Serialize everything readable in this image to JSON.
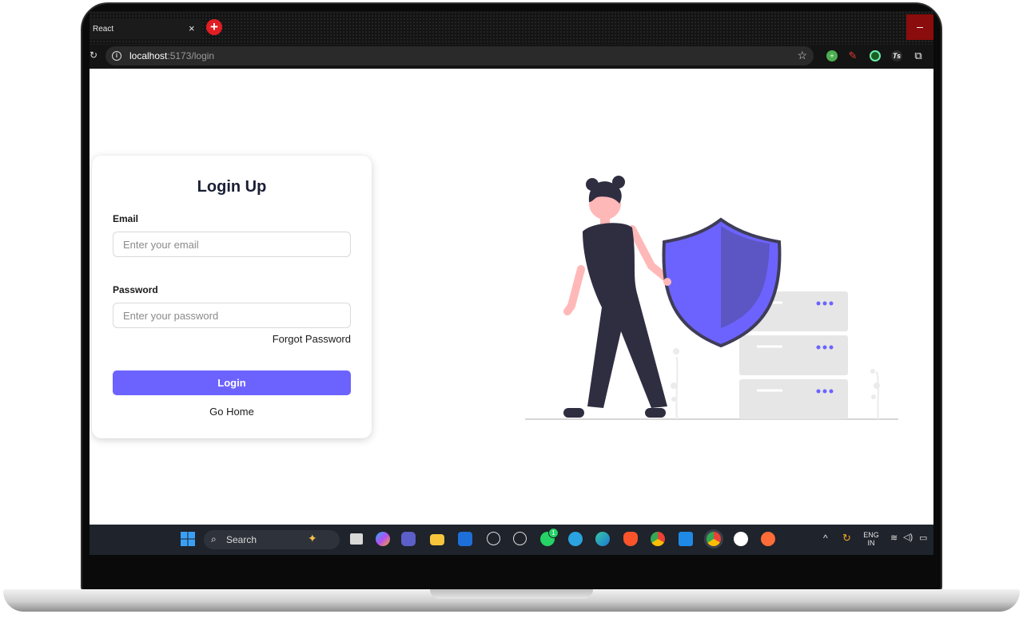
{
  "browser": {
    "tab_title": "React",
    "tab_close": "×",
    "new_tab": "+",
    "minimize": "–",
    "url_host": "localhost",
    "url_rest": ":5173/login"
  },
  "login_form": {
    "title": "Login Up",
    "email_label": "Email",
    "email_placeholder": "Enter your email",
    "email_value": "",
    "password_label": "Password",
    "password_placeholder": "Enter your password",
    "password_value": "",
    "forgot_password": "Forgot Password",
    "login_button": "Login",
    "go_home": "Go Home"
  },
  "illustration": {
    "accent_color": "#6c63ff",
    "dark_color": "#2f2e41",
    "skin_color": "#ffb8b8"
  },
  "taskbar": {
    "search_label": "Search",
    "language_top": "ENG",
    "language_bottom": "IN",
    "whatsapp_badge": "1",
    "apps": [
      "start-icon",
      "widgets-icon",
      "task-view-icon",
      "copilot-icon",
      "teams-icon",
      "file-explorer-icon",
      "store-icon",
      "dell-icon",
      "openai-icon",
      "whatsapp-icon",
      "telegram-icon",
      "edge-icon",
      "brave-icon",
      "chrome-icon",
      "vscode-icon",
      "chrome-dev-icon",
      "mongodb-icon",
      "postman-icon"
    ]
  }
}
